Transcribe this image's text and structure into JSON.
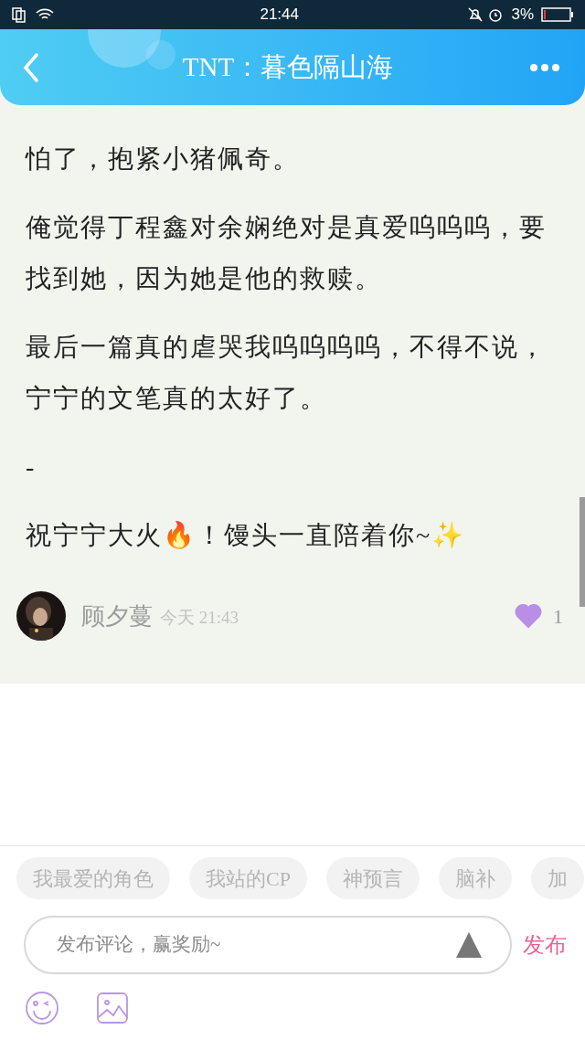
{
  "status_bar": {
    "time": "21:44",
    "battery": "3%"
  },
  "header": {
    "title": "TNT：暮色隔山海"
  },
  "paragraphs": [
    "怕了，抱紧小猪佩奇。",
    "俺觉得丁程鑫对余娴绝对是真爱呜呜呜，要找到她，因为她是他的救赎。",
    "最后一篇真的虐哭我呜呜呜呜，不得不说，宁宁的文笔真的太好了。",
    "-",
    "祝宁宁大火🔥！馒头一直陪着你~✨"
  ],
  "author": {
    "name": "顾夕蔓",
    "time": "今天 21:43",
    "likes": "1",
    "liked": true
  },
  "tags": [
    "我最爱的角色",
    "我站的CP",
    "神预言",
    "脑补",
    "加"
  ],
  "comment": {
    "placeholder": "发布评论，赢奖励~",
    "submit": "发布"
  }
}
